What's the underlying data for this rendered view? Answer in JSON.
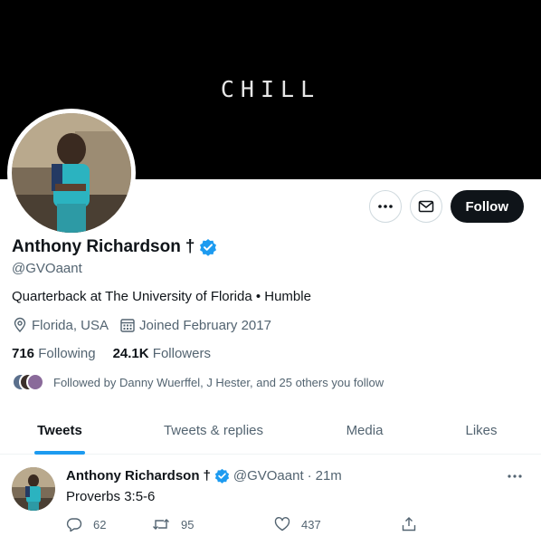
{
  "banner": {
    "text": "CHILL"
  },
  "actions": {
    "follow_label": "Follow"
  },
  "profile": {
    "name": "Anthony Richardson",
    "name_suffix": "†",
    "handle": "@GVOaant",
    "bio": "Quarterback at The University of Florida • Humble",
    "location": "Florida, USA",
    "joined": "Joined February 2017",
    "following_count": "716",
    "following_label": "Following",
    "followers_count": "24.1K",
    "followers_label": "Followers",
    "followed_by": "Followed by Danny Wuerffel, J Hester, and 25 others you follow"
  },
  "tabs": [
    {
      "label": "Tweets",
      "active": true
    },
    {
      "label": "Tweets & replies",
      "active": false
    },
    {
      "label": "Media",
      "active": false
    },
    {
      "label": "Likes",
      "active": false
    }
  ],
  "tweet": {
    "name": "Anthony Richardson",
    "name_suffix": "†",
    "handle": "@GVOaant",
    "separator": "·",
    "time": "21m",
    "text": "Proverbs 3:5-6",
    "replies": "62",
    "retweets": "95",
    "likes": "437"
  },
  "icons": {
    "more": "more-icon",
    "message": "mail-icon",
    "verified": "verified-badge-icon",
    "location": "location-icon",
    "calendar": "calendar-icon",
    "reply": "reply-icon",
    "retweet": "retweet-icon",
    "like": "heart-icon",
    "share": "share-icon"
  },
  "colors": {
    "accent": "#1d9bf0",
    "text": "#0f1419",
    "muted": "#536471",
    "banner": "#000000",
    "follow_button": "#0f1419"
  }
}
